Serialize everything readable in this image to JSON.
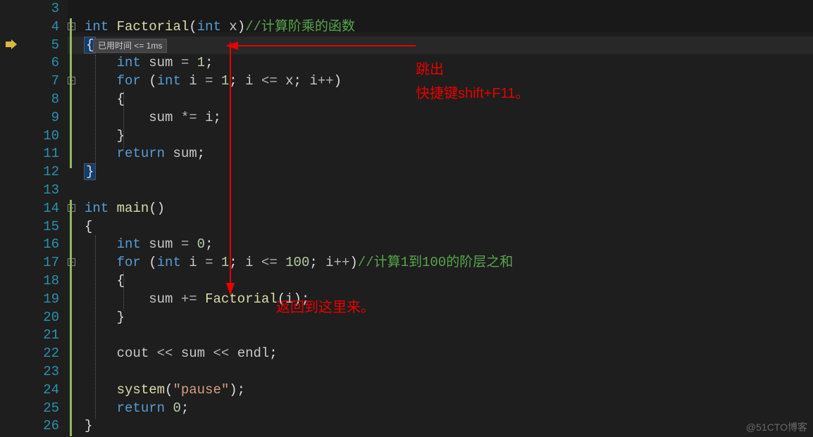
{
  "line_numbers": [
    "3",
    "4",
    "5",
    "6",
    "7",
    "8",
    "9",
    "10",
    "11",
    "12",
    "13",
    "14",
    "15",
    "16",
    "17",
    "18",
    "19",
    "20",
    "21",
    "22",
    "23",
    "24",
    "25",
    "26"
  ],
  "tooltip": {
    "text": "已用时间 <= 1ms"
  },
  "annotations": {
    "lbl1": "跳出",
    "lbl2": "快捷键shift+F11。",
    "lbl3": "返回到这里来。"
  },
  "code": {
    "l4": {
      "kw1": "int",
      "fn": "Factorial",
      "kw2": "int",
      "var": "x",
      "cmt": "//计算阶乘的函数"
    },
    "l5": {
      "brace": "{"
    },
    "l6": {
      "kw": "int",
      "var": "sum",
      "op": "=",
      "num": "1",
      "semi": ";"
    },
    "l7": {
      "kw1": "for",
      "kw2": "int",
      "var1": "i",
      "op1": "=",
      "num1": "1",
      "var2": "i",
      "op2": "<=",
      "var3": "x",
      "var4": "i",
      "op3": "++"
    },
    "l8": {
      "brace": "{"
    },
    "l9": {
      "var1": "sum",
      "op": "*=",
      "var2": "i",
      "semi": ";"
    },
    "l10": {
      "brace": "}"
    },
    "l11": {
      "kw": "return",
      "var": "sum",
      "semi": ";"
    },
    "l12": {
      "brace": "}"
    },
    "l14": {
      "kw": "int",
      "fn": "main"
    },
    "l15": {
      "brace": "{"
    },
    "l16": {
      "kw": "int",
      "var": "sum",
      "op": "=",
      "num": "0",
      "semi": ";"
    },
    "l17": {
      "kw1": "for",
      "kw2": "int",
      "var1": "i",
      "op1": "=",
      "num1": "1",
      "var2": "i",
      "op2": "<=",
      "num2": "100",
      "var3": "i",
      "op3": "++",
      "cmt": "//计算1到100的阶层之和"
    },
    "l18": {
      "brace": "{"
    },
    "l19": {
      "var1": "sum",
      "op": "+=",
      "fn": "Factorial",
      "var2": "i",
      "semi": ";"
    },
    "l20": {
      "brace": "}"
    },
    "l22": {
      "id": "cout",
      "op1": "<<",
      "var": "sum",
      "op2": "<<",
      "id2": "endl",
      "semi": ";"
    },
    "l24": {
      "fn": "system",
      "str": "\"pause\"",
      "semi": ";"
    },
    "l25": {
      "kw": "return",
      "num": "0",
      "semi": ";"
    },
    "l26": {
      "brace": "}"
    }
  },
  "watermark": "@51CTO博客"
}
